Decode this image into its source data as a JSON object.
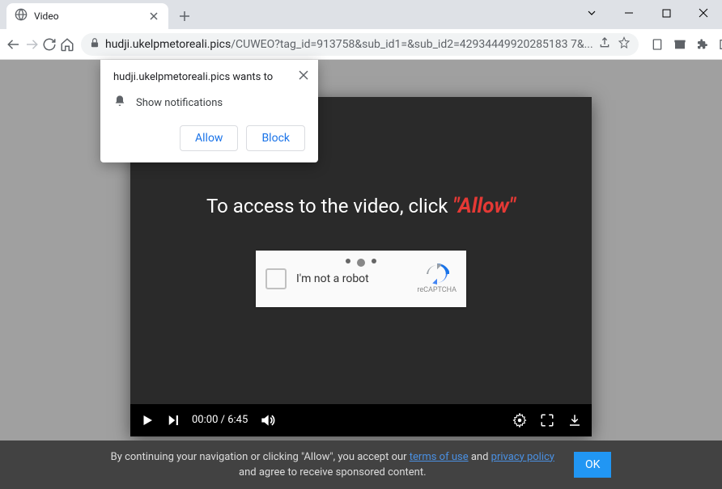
{
  "tab": {
    "title": "Video"
  },
  "url": {
    "domain": "hudji.ukelpmetoreali.pics",
    "path": "/CUWEO?tag_id=913758&sub_id1=&sub_id2=42934449920285183 7&..."
  },
  "notification": {
    "title": "hudji.ukelpmetoreali.pics wants to",
    "permission": "Show notifications",
    "allow": "Allow",
    "block": "Block"
  },
  "player": {
    "headline_pre": "To access to the video, click ",
    "headline_allow": "\"Allow\"",
    "captcha_label": "I'm not a robot",
    "captcha_badge": "reCAPTCHA",
    "time_current": "00:00",
    "time_total": "6:45"
  },
  "banner": {
    "line1_pre": "By continuing your navigation or clicking \"Allow\", you accept our ",
    "terms": "terms of use",
    "and": " and ",
    "privacy": "privacy policy",
    "line2": "and agree to receive sponsored content.",
    "ok": "OK"
  }
}
